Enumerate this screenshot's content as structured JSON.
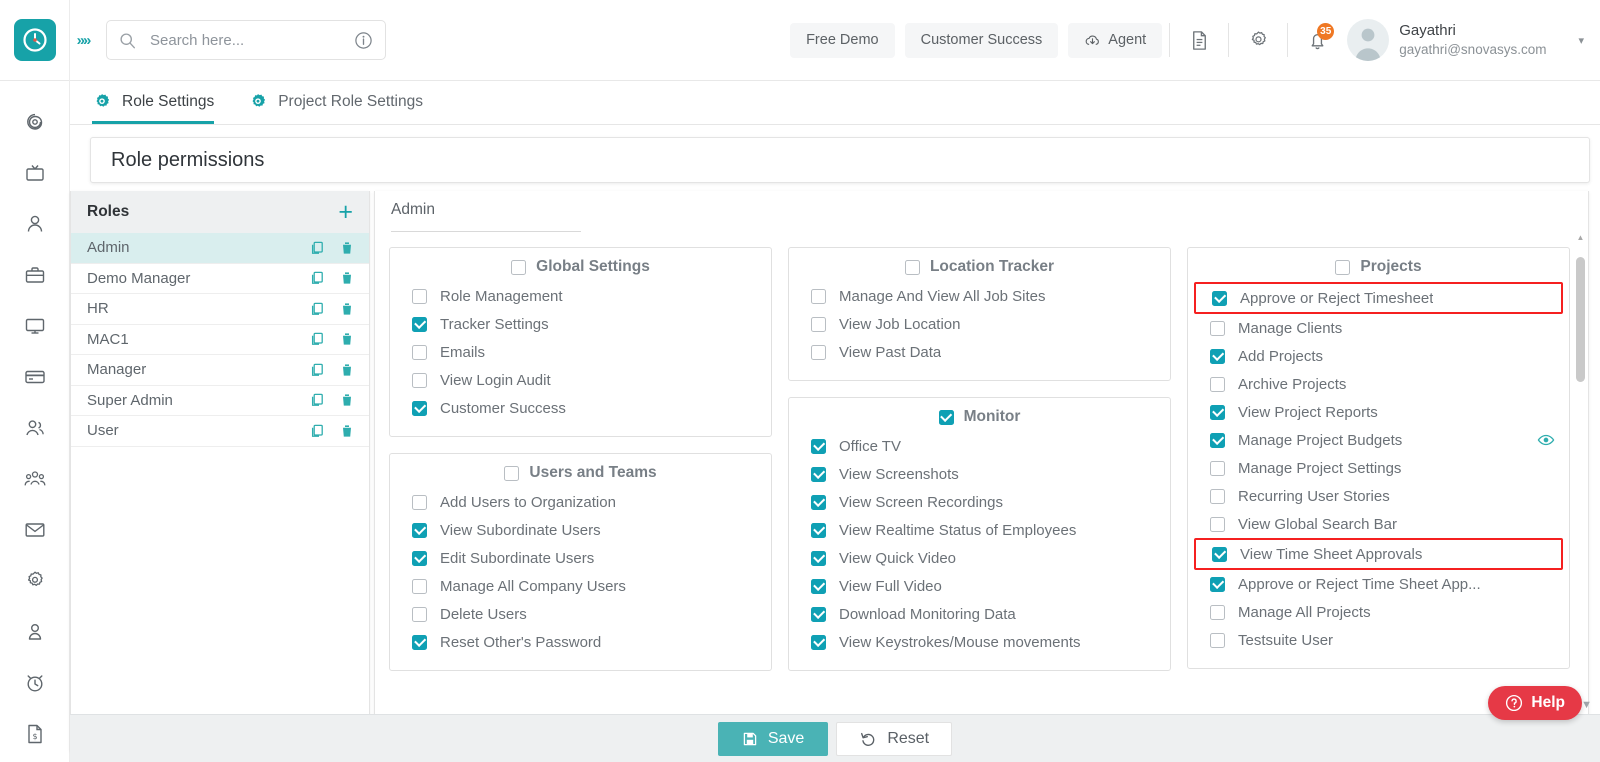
{
  "header": {
    "logo_icon": "clock-logo-icon",
    "expand_icon": "chevrons-right-icon",
    "search": {
      "placeholder": "Search here...",
      "value": "",
      "icon": "search-icon",
      "info_icon": "info-circle-icon"
    },
    "buttons": [
      {
        "label": "Free Demo",
        "name": "free-demo-button",
        "icon": null
      },
      {
        "label": "Customer Success",
        "name": "customer-success-button",
        "icon": null
      },
      {
        "label": "Agent",
        "name": "agent-button",
        "icon": "cloud-download-icon"
      }
    ],
    "icons": [
      {
        "name": "document-icon"
      },
      {
        "name": "gear-icon"
      }
    ],
    "notification": {
      "name": "bell-icon",
      "badge": "35",
      "badge_color": "#ef7824"
    },
    "profile": {
      "name": "Gayathri",
      "email": "gayathri@snovasys.com",
      "caret": "▾"
    }
  },
  "sidebar": {
    "items": [
      {
        "name": "sidebar-item-dashboard",
        "icon": "spiral-icon"
      },
      {
        "name": "sidebar-item-office-tv",
        "icon": "tv-icon"
      },
      {
        "name": "sidebar-item-profile",
        "icon": "user-icon"
      },
      {
        "name": "sidebar-item-projects",
        "icon": "briefcase-icon"
      },
      {
        "name": "sidebar-item-monitor",
        "icon": "monitor-icon"
      },
      {
        "name": "sidebar-item-payments",
        "icon": "credit-card-icon"
      },
      {
        "name": "sidebar-item-users",
        "icon": "users-icon"
      },
      {
        "name": "sidebar-item-teams",
        "icon": "team-group-icon"
      },
      {
        "name": "sidebar-item-mail",
        "icon": "envelope-icon"
      },
      {
        "name": "sidebar-item-settings",
        "icon": "gear-icon"
      },
      {
        "name": "sidebar-item-account",
        "icon": "user-badge-icon"
      },
      {
        "name": "sidebar-item-timer",
        "icon": "alarm-clock-icon"
      },
      {
        "name": "sidebar-item-invoices",
        "icon": "invoice-icon"
      }
    ]
  },
  "tabs": [
    {
      "label": "Role Settings",
      "active": true,
      "icon": "gear-settings-icon"
    },
    {
      "label": "Project Role Settings",
      "active": false,
      "icon": "gear-settings-icon"
    }
  ],
  "page_title": "Role permissions",
  "roles_panel": {
    "header_label": "Roles",
    "add_icon": "plus-icon",
    "copy_icon": "copy-icon",
    "delete_icon": "trash-icon",
    "rows": [
      {
        "label": "Admin",
        "selected": true
      },
      {
        "label": "Demo Manager",
        "selected": false
      },
      {
        "label": "HR",
        "selected": false
      },
      {
        "label": "MAC1",
        "selected": false
      },
      {
        "label": "Manager",
        "selected": false
      },
      {
        "label": "Super Admin",
        "selected": false
      },
      {
        "label": "User",
        "selected": false
      }
    ]
  },
  "permissions": {
    "selected_role": "Admin",
    "groups": [
      {
        "title": "Global Settings",
        "group_checked": false,
        "column": 0,
        "items": [
          {
            "label": "Role Management",
            "checked": false
          },
          {
            "label": "Tracker Settings",
            "checked": true
          },
          {
            "label": "Emails",
            "checked": false
          },
          {
            "label": "View Login Audit",
            "checked": false
          },
          {
            "label": "Customer Success",
            "checked": true
          }
        ]
      },
      {
        "title": "Users and Teams",
        "group_checked": false,
        "column": 0,
        "items": [
          {
            "label": "Add Users to Organization",
            "checked": false
          },
          {
            "label": "View Subordinate Users",
            "checked": true
          },
          {
            "label": "Edit Subordinate Users",
            "checked": true
          },
          {
            "label": "Manage All Company Users",
            "checked": false
          },
          {
            "label": "Delete Users",
            "checked": false
          },
          {
            "label": "Reset Other's Password",
            "checked": true
          }
        ]
      },
      {
        "title": "Location Tracker",
        "group_checked": false,
        "column": 1,
        "items": [
          {
            "label": "Manage And View All Job Sites",
            "checked": false
          },
          {
            "label": "View Job Location",
            "checked": false
          },
          {
            "label": "View Past Data",
            "checked": false
          }
        ]
      },
      {
        "title": "Monitor",
        "group_checked": true,
        "column": 1,
        "items": [
          {
            "label": "Office TV",
            "checked": true
          },
          {
            "label": "View Screenshots",
            "checked": true
          },
          {
            "label": "View Screen Recordings",
            "checked": true
          },
          {
            "label": "View Realtime Status of Employees",
            "checked": true
          },
          {
            "label": "View Quick Video",
            "checked": true
          },
          {
            "label": "View Full Video",
            "checked": true
          },
          {
            "label": "Download Monitoring Data",
            "checked": true
          },
          {
            "label": "View Keystrokes/Mouse movements",
            "checked": true
          }
        ]
      },
      {
        "title": "Projects",
        "group_checked": false,
        "column": 2,
        "items": [
          {
            "label": "Approve or Reject Timesheet",
            "checked": true,
            "highlight": true
          },
          {
            "label": "Manage Clients",
            "checked": false
          },
          {
            "label": "Add Projects",
            "checked": true
          },
          {
            "label": "Archive Projects",
            "checked": false
          },
          {
            "label": "View Project Reports",
            "checked": true
          },
          {
            "label": "Manage Project Budgets",
            "checked": true,
            "eye_icon": "eye-icon"
          },
          {
            "label": "Manage Project Settings",
            "checked": false
          },
          {
            "label": "Recurring User Stories",
            "checked": false
          },
          {
            "label": "View Global Search Bar",
            "checked": false
          },
          {
            "label": "View Time Sheet Approvals",
            "checked": true,
            "highlight": true
          },
          {
            "label": "Approve or Reject Time Sheet App...",
            "checked": true
          },
          {
            "label": "Manage All Projects",
            "checked": false
          },
          {
            "label": "Testsuite User",
            "checked": false
          }
        ]
      }
    ]
  },
  "footer": {
    "save_label": "Save",
    "save_icon": "save-disk-icon",
    "reset_label": "Reset",
    "reset_icon": "undo-icon"
  },
  "help": {
    "label": "Help",
    "icon": "question-circle-icon"
  },
  "colors": {
    "accent_teal": "#17a2a8",
    "checkbox_teal": "#0fa0b4",
    "highlight_red": "#f52020",
    "help_red": "#e63946",
    "badge_orange": "#ef7824",
    "row_selected": "#d9eeee",
    "save_green": "#4ab3b5"
  }
}
